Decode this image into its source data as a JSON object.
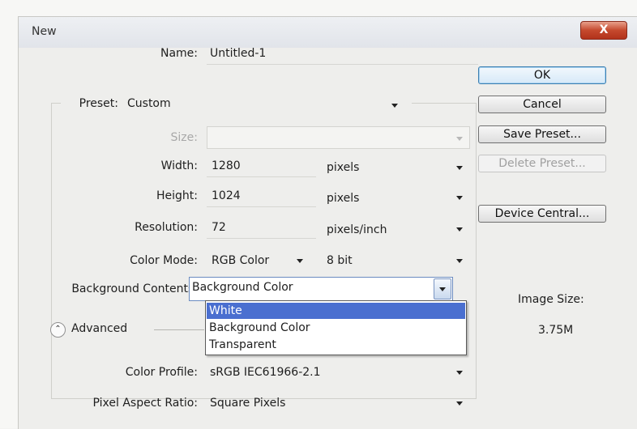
{
  "dialog": {
    "title": "New",
    "close_label": "X"
  },
  "form": {
    "name_label": "Name:",
    "name_value": "Untitled-1",
    "preset_label": "Preset:",
    "preset_value": "Custom",
    "size_label": "Size:",
    "size_value": "",
    "width_label": "Width:",
    "width_value": "1280",
    "width_unit": "pixels",
    "height_label": "Height:",
    "height_value": "1024",
    "height_unit": "pixels",
    "resolution_label": "Resolution:",
    "resolution_value": "72",
    "resolution_unit": "pixels/inch",
    "color_mode_label": "Color Mode:",
    "color_mode_value": "RGB Color",
    "bit_depth_value": "8 bit",
    "background_label": "Background Contents:",
    "background_value": "Background Color",
    "background_options": [
      "White",
      "Background Color",
      "Transparent"
    ],
    "background_highlighted": "White",
    "advanced_label": "Advanced",
    "color_profile_label": "Color Profile:",
    "color_profile_value": "sRGB IEC61966-2.1",
    "pixel_aspect_label": "Pixel Aspect Ratio:",
    "pixel_aspect_value": "Square Pixels"
  },
  "buttons": {
    "ok": "OK",
    "cancel": "Cancel",
    "save_preset": "Save Preset...",
    "delete_preset": "Delete Preset...",
    "device_central": "Device Central..."
  },
  "image_size": {
    "label": "Image Size:",
    "value": "3.75M"
  },
  "colors": {
    "highlight": "#4a6fd0",
    "close_button": "#c5492d",
    "default_button_border": "#3c7fb1"
  }
}
